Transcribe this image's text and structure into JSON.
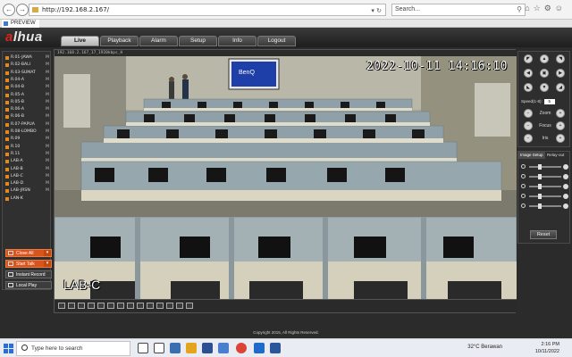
{
  "browser": {
    "url": "http://192.168.2.167/",
    "search_placeholder": "Search...",
    "tab_title": "PREVIEW"
  },
  "app": {
    "logo_prefix": "a",
    "logo_rest": "lhua",
    "nav": [
      "Live",
      "Playback",
      "Alarm",
      "Setup",
      "Info",
      "Logout"
    ],
    "active_nav": "Live",
    "footer": "Copyright 2015, All Rights Reserved."
  },
  "channels": [
    {
      "label": "R.01-JAWA",
      "flag": "M"
    },
    {
      "label": "R.02-BALI",
      "flag": "M"
    },
    {
      "label": "R.03-SUMAT",
      "flag": "M"
    },
    {
      "label": "R.04-A",
      "flag": "M"
    },
    {
      "label": "R.04-B",
      "flag": "M"
    },
    {
      "label": "R.05-A",
      "flag": "M"
    },
    {
      "label": "R.05-B",
      "flag": "M"
    },
    {
      "label": "R.06-A",
      "flag": "M"
    },
    {
      "label": "R.06-B",
      "flag": "M"
    },
    {
      "label": "R.07-PAPUA",
      "flag": "M"
    },
    {
      "label": "R.08-LOMBO",
      "flag": "M"
    },
    {
      "label": "R.09",
      "flag": "M"
    },
    {
      "label": "R.10",
      "flag": "M"
    },
    {
      "label": "R.11",
      "flag": "M"
    },
    {
      "label": "LAB-A",
      "flag": "M"
    },
    {
      "label": "LAB-B",
      "flag": "M"
    },
    {
      "label": "LAB-C",
      "flag": "M"
    },
    {
      "label": "LAB-D",
      "flag": "M"
    },
    {
      "label": "LAB-JRSN",
      "flag": "M"
    },
    {
      "label": "LAN-K",
      "flag": ""
    }
  ],
  "left_buttons": {
    "close_all": "Close All",
    "start_talk": "Start Talk",
    "instant_record": "Instant Record",
    "local_play": "Local Play"
  },
  "video": {
    "stream_info": "192.168.2.167_17_1920kbps_H",
    "timestamp": "2022-10-11  14:16:10",
    "camera_label": "LAB-C",
    "projector_text": "BenQ"
  },
  "ptz": {
    "speed_label": "Speed(1-8):",
    "speed_value": "5",
    "zoom": "Zoom",
    "focus": "Focus",
    "iris": "Iris"
  },
  "image_setup": {
    "tabs": [
      "Image Setup",
      "Relay-out"
    ],
    "sliders": [
      0.3,
      0.3,
      0.3,
      0.3,
      0.3
    ],
    "reset": "Reset"
  },
  "taskbar": {
    "search_placeholder": "Type here to search",
    "weather": "32°C  Berawan",
    "time": "2:16 PM",
    "date": "10/11/2022"
  }
}
